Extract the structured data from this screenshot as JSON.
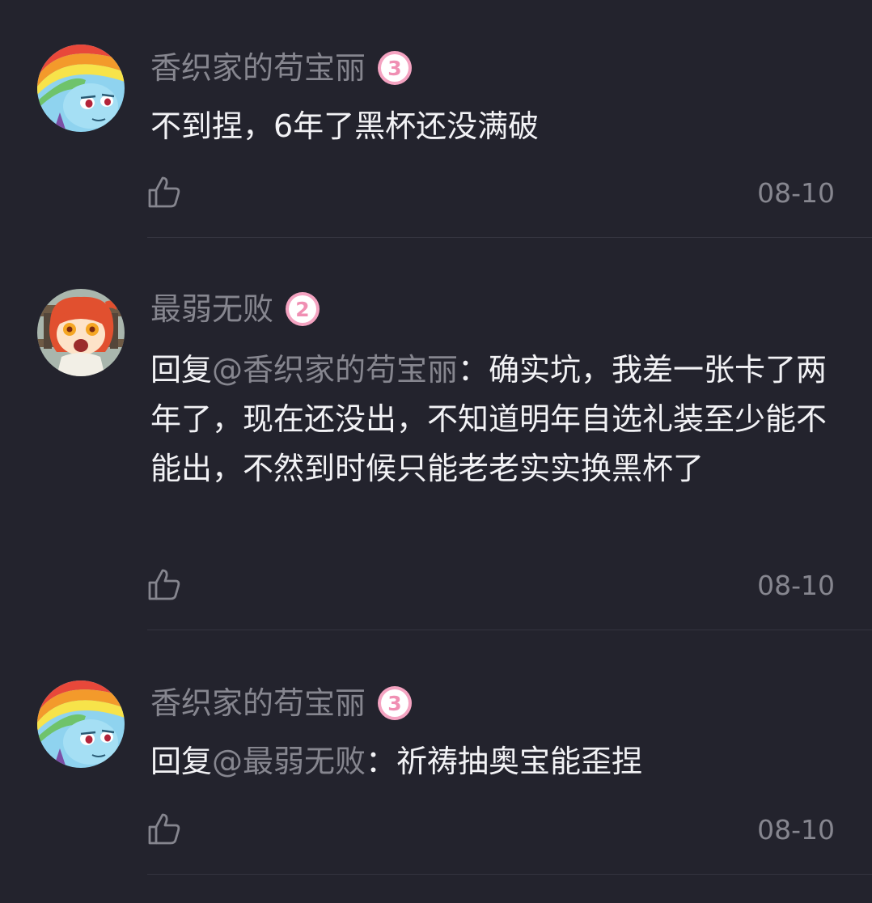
{
  "comments": [
    {
      "username": "香织家的苟宝丽",
      "level": "3",
      "text": "不到捏，6年了黑杯还没满破",
      "date": "08-10"
    },
    {
      "username": "最弱无败",
      "level": "2",
      "reply_prefix": "回复",
      "reply_mention": "@香织家的苟宝丽",
      "reply_sep": "：",
      "text": "确实坑，我差一张卡了两年了，现在还没出，不知道明年自选礼装至少能不能出，不然到时候只能老老实实换黑杯了",
      "date": "08-10"
    },
    {
      "username": "香织家的苟宝丽",
      "level": "3",
      "reply_prefix": "回复",
      "reply_mention": "@最弱无败",
      "reply_sep": "：",
      "text": "祈祷抽奥宝能歪捏",
      "date": "08-10"
    }
  ],
  "colors": {
    "background": "#23232d",
    "text_primary": "#f2f2f5",
    "text_secondary": "#86868f",
    "badge_pink": "#f4a3c1",
    "divider": "#34343f"
  },
  "icons": {
    "like": "thumbs-up-icon",
    "level": "level-badge-icon"
  }
}
